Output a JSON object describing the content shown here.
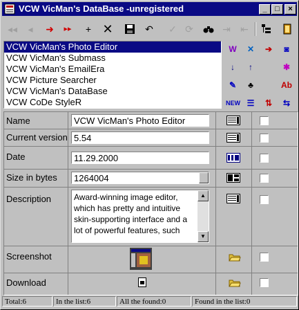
{
  "window": {
    "title": "VCW VicMan's DataBase -unregistered"
  },
  "programs": [
    "VCW VicMan's Photo Editor",
    "VCW VicMan's Submass",
    "VCW VicMan's EmailEra",
    "VCW Picture Searcher",
    "VCW VicMan's DataBase",
    "VCW CoDe StyleR"
  ],
  "selected_index": 0,
  "fields": {
    "name_label": "Name",
    "name_value": "VCW VicMan's Photo Editor",
    "version_label": "Current version",
    "version_value": "5.54",
    "date_label": "Date",
    "date_value": "11.29.2000",
    "size_label": "Size in bytes",
    "size_value": "1264004",
    "description_label": "Description",
    "description_value": "Award-winning image editor, which has pretty and intuitive skin-supporting interface and a lot of powerful features, such",
    "screenshot_label": "Screenshot",
    "download_label": "Download"
  },
  "status": {
    "total": "Total:6",
    "in_list": "In the list:6",
    "all_found": "All the found:0",
    "found_in_list": "Found in the list:0"
  },
  "colors": {
    "titlebar": "#0a0a84",
    "selection": "#0a0a84",
    "face": "#c0c0c0"
  }
}
